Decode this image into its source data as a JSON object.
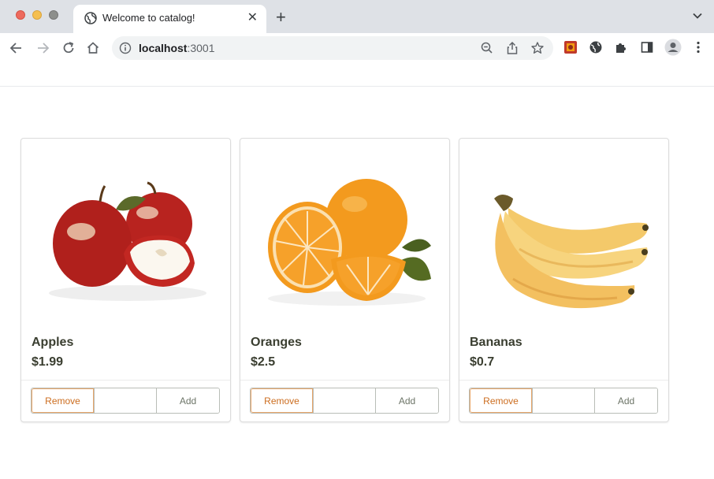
{
  "browser": {
    "tab_title": "Welcome to catalog!",
    "tab_close": "✕",
    "new_tab": "+",
    "url_host": "localhost",
    "url_port": ":3001"
  },
  "colors": {
    "remove_accent": "#cc6d1f",
    "text_dark": "#3a3e30",
    "chrome_bg": "#dee1e6"
  },
  "products": [
    {
      "name": "Apples",
      "price": "$1.99",
      "image": "apples-image",
      "remove_label": "Remove",
      "add_label": "Add",
      "quantity": ""
    },
    {
      "name": "Oranges",
      "price": "$2.5",
      "image": "oranges-image",
      "remove_label": "Remove",
      "add_label": "Add",
      "quantity": ""
    },
    {
      "name": "Bananas",
      "price": "$0.7",
      "image": "bananas-image",
      "remove_label": "Remove",
      "add_label": "Add",
      "quantity": ""
    }
  ]
}
